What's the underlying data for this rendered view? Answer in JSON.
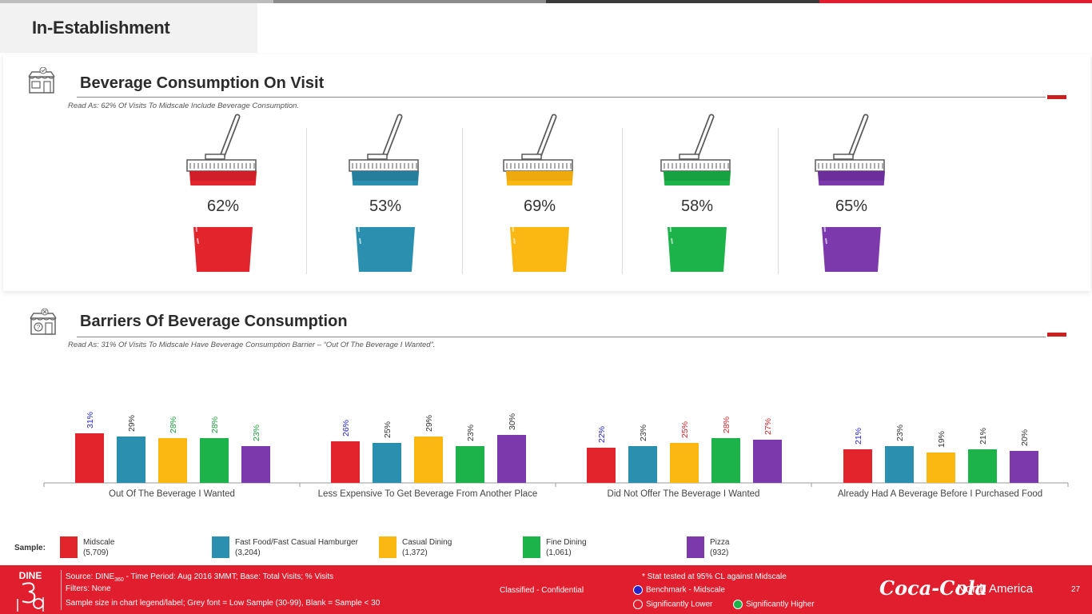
{
  "colors": {
    "topbar": [
      "#bdbdbd",
      "#8c8c8c",
      "#3a3a3a",
      "#e01e2d"
    ],
    "accent": "#cc1f1f",
    "footer_bg": "#e01e2d"
  },
  "page_title": "In-Establishment",
  "section1": {
    "icon": "store-check-icon",
    "title": "Beverage Consumption On Visit",
    "read_as": "Read As: 62% Of Visits To Midscale Include Beverage Consumption.",
    "cups": [
      {
        "segment": "Midscale",
        "value": 62,
        "label": "62%",
        "color": "#e2242d",
        "shade": "#c51d24"
      },
      {
        "segment": "Fast Food/Fast Casual Hamburger",
        "value": 53,
        "label": "53%",
        "color": "#2b8fb0",
        "shade": "#227590"
      },
      {
        "segment": "Casual Dining",
        "value": 69,
        "label": "69%",
        "color": "#fbb812",
        "shade": "#e59f0b"
      },
      {
        "segment": "Fine Dining",
        "value": 58,
        "label": "58%",
        "color": "#1cb34a",
        "shade": "#16953c"
      },
      {
        "segment": "Pizza",
        "value": 65,
        "label": "65%",
        "color": "#7b39ab",
        "shade": "#63288f"
      }
    ]
  },
  "section2": {
    "icon": "store-question-icon",
    "title": "Barriers Of Beverage Consumption",
    "read_as": "Read As: 31% Of Visits To Midscale Have Beverage Consumption Barrier – “Out Of The Beverage I Wanted”."
  },
  "chart_data": {
    "type": "bar",
    "categories": [
      "Out Of The Beverage I Wanted",
      "Less Expensive To Get Beverage From Another Place",
      "Did Not Offer The Beverage I Wanted",
      "Already Had A Beverage Before I Purchased Food"
    ],
    "series": [
      {
        "name": "Midscale",
        "color": "#e2242d",
        "values": [
          31,
          26,
          22,
          21
        ],
        "label_colors": [
          "#2525cc",
          "#2525cc",
          "#2525cc",
          "#2525cc"
        ]
      },
      {
        "name": "Fast Food/Fast Casual Hamburger",
        "color": "#2b8fb0",
        "values": [
          29,
          25,
          23,
          23
        ],
        "label_colors": [
          "#333333",
          "#333333",
          "#333333",
          "#333333"
        ]
      },
      {
        "name": "Casual Dining",
        "color": "#fbb812",
        "values": [
          28,
          29,
          25,
          19
        ],
        "label_colors": [
          "#1a9e3a",
          "#333333",
          "#d8232a",
          "#333333"
        ]
      },
      {
        "name": "Fine Dining",
        "color": "#1cb34a",
        "values": [
          28,
          23,
          28,
          21
        ],
        "label_colors": [
          "#1a9e3a",
          "#333333",
          "#d8232a",
          "#333333"
        ]
      },
      {
        "name": "Pizza",
        "color": "#7b39ab",
        "values": [
          23,
          30,
          27,
          20
        ],
        "label_colors": [
          "#1a9e3a",
          "#333333",
          "#d8232a",
          "#333333"
        ]
      }
    ],
    "ylim": [
      0,
      35
    ],
    "grid": false
  },
  "legend": {
    "sample_label": "Sample:",
    "items": [
      {
        "name": "Midscale",
        "n": "(5,709)",
        "color": "#e2242d"
      },
      {
        "name": "Fast Food/Fast Casual Hamburger",
        "n": "(3,204)",
        "color": "#2b8fb0"
      },
      {
        "name": "Casual Dining",
        "n": "(1,372)",
        "color": "#fbb812"
      },
      {
        "name": "Fine Dining",
        "n": "(1,061)",
        "color": "#1cb34a"
      },
      {
        "name": "Pizza",
        "n": "(932)",
        "color": "#7b39ab"
      }
    ]
  },
  "footer": {
    "logo_text": "DINE",
    "source_prefix": "Source: DINE",
    "source_sub": "360",
    "source_rest": " - Time Period: Aug 2016 3MMT; Base: Total Visits; % Visits",
    "filters": "Filters: None",
    "sample_note": "Sample size in chart legend/label;  Grey font = Low Sample (30-99), Blank = Sample < 30",
    "classification": "Classified - Confidential",
    "stat_note": "* Stat tested at 95% CL against Midscale",
    "benchmark": "Benchmark - Midscale",
    "lower": "Significantly Lower",
    "higher": "Significantly Higher",
    "brand": "Coca-Cola",
    "region": "North America",
    "page_number": "27",
    "benchmark_color": "#2525cc",
    "lower_color": "#e01e2d",
    "higher_color": "#1cb34a"
  }
}
